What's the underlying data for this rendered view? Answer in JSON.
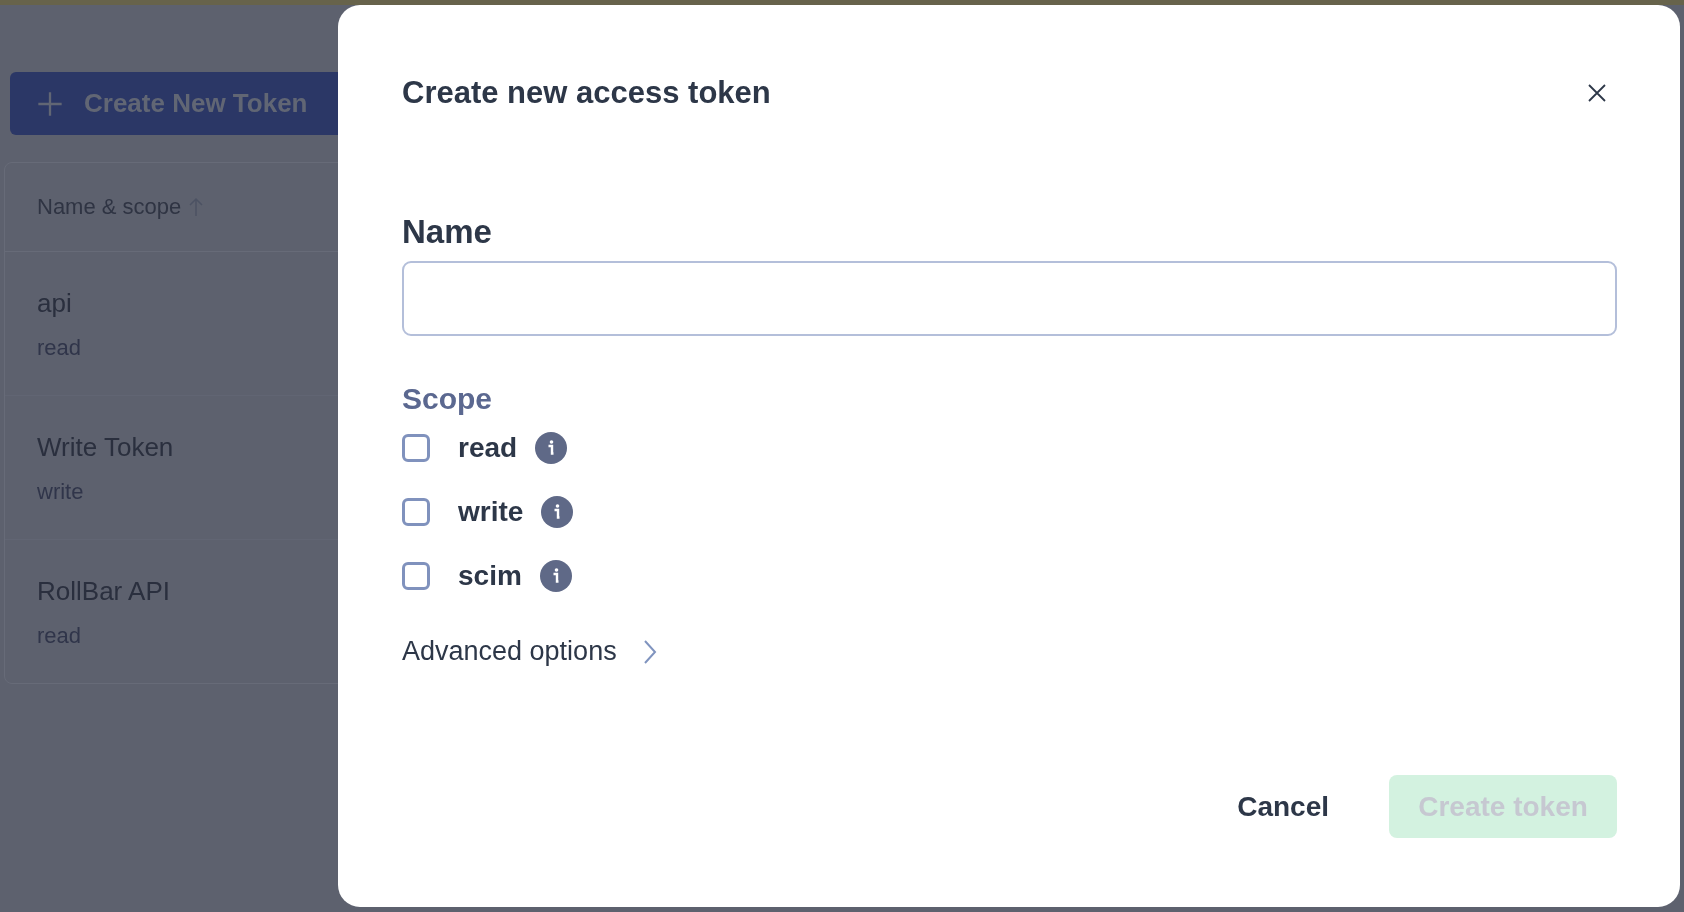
{
  "background": {
    "create_button": "Create New Token",
    "table": {
      "columns": [
        {
          "label": "Name & scope",
          "sorted": true
        }
      ],
      "rows": [
        {
          "name": "api",
          "scope": "read"
        },
        {
          "name": "Write Token",
          "scope": "write"
        },
        {
          "name": "RollBar API",
          "scope": "read"
        }
      ]
    }
  },
  "dialog": {
    "title": "Create new access token",
    "name_label": "Name",
    "scope_label": "Scope",
    "scopes": [
      {
        "label": "read",
        "checked": false
      },
      {
        "label": "write",
        "checked": false
      },
      {
        "label": "scim",
        "checked": false
      }
    ],
    "advanced": {
      "label": "Advanced options",
      "expanded": false
    },
    "buttons": [
      {
        "label": "Cancel",
        "kind": "secondary",
        "disabled": false
      },
      {
        "label": "Create token",
        "kind": "primary",
        "disabled": true
      }
    ]
  }
}
